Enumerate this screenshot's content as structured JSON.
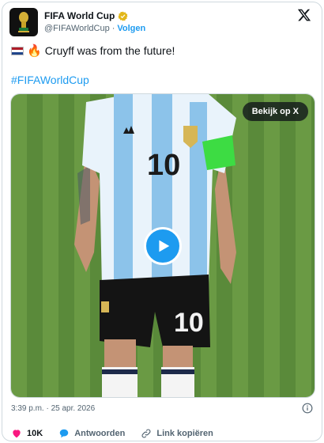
{
  "account": {
    "display_name": "FIFA World Cup",
    "handle": "@FIFAWorldCup",
    "separator": "·",
    "follow_label": "Volgen"
  },
  "tweet": {
    "text": "Cruyff was from the future!",
    "hashtag": "#FIFAWorldCup",
    "watch_label": "Bekijk op X",
    "timestamp": "3:39 p.m. · 25 apr. 2026"
  },
  "actions": {
    "likes": "10K",
    "reply_label": "Antwoorden",
    "copy_link_label": "Link kopiëren"
  },
  "colors": {
    "accent": "#1d9bf0",
    "like_red": "#f91880",
    "verified_gold": "#e2b719"
  }
}
